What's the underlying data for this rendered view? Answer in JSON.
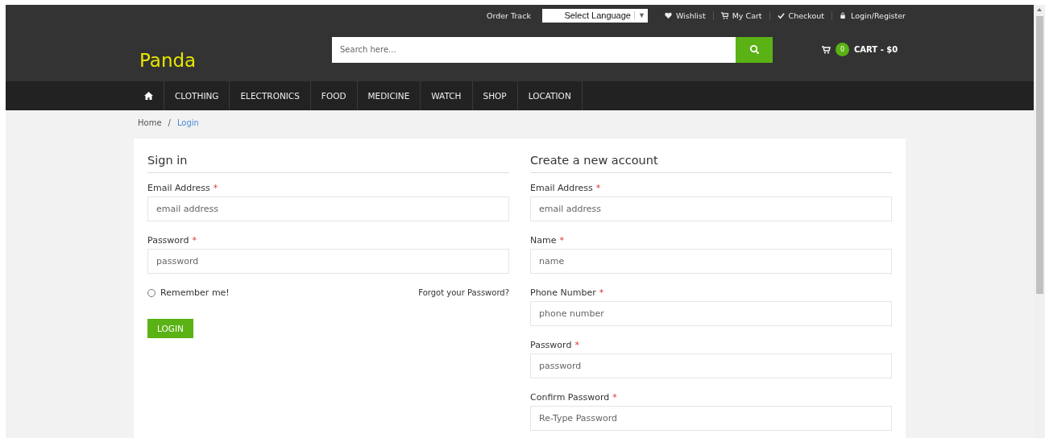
{
  "top_links": [
    {
      "kind": "text",
      "label": "Order Track"
    },
    {
      "kind": "select",
      "label": "Select Language",
      "caret": "▼"
    },
    {
      "kind": "wishlist",
      "label": "Wishlist"
    },
    {
      "kind": "cart",
      "label": "My Cart"
    },
    {
      "kind": "checkout",
      "label": "Checkout"
    },
    {
      "kind": "account",
      "label": "Login/Register"
    }
  ],
  "logo": "Panda",
  "search": {
    "placeholder": "Search here..."
  },
  "cart": {
    "count": "0",
    "label": "CART - $0"
  },
  "nav": [
    {
      "kind": "home"
    },
    {
      "kind": "text",
      "label": "CLOTHING"
    },
    {
      "kind": "text",
      "label": "ELECTRONICS"
    },
    {
      "kind": "text",
      "label": "FOOD"
    },
    {
      "kind": "text",
      "label": "MEDICINE"
    },
    {
      "kind": "text",
      "label": "WATCH"
    },
    {
      "kind": "text",
      "label": "SHOP"
    },
    {
      "kind": "text",
      "label": "LOCATION"
    }
  ],
  "breadcrumb": {
    "separator": "/",
    "items": [
      {
        "label": "Home",
        "selected": false
      },
      {
        "label": "Login",
        "selected": true
      }
    ]
  },
  "sign_in": {
    "title": "Sign in",
    "fields": [
      {
        "label": "Email Address",
        "required_mark": "*",
        "placeholder": "email address"
      },
      {
        "label": "Password",
        "required_mark": "*",
        "placeholder": "password"
      }
    ],
    "remember": {
      "label": "Remember me!",
      "checked": false
    },
    "forgot": "Forgot your Password?",
    "button": "LOGIN"
  },
  "create_account": {
    "title": "Create a new account",
    "fields": [
      {
        "label": "Email Address",
        "required_mark": "*",
        "placeholder": "email address"
      },
      {
        "label": "Name",
        "required_mark": "*",
        "placeholder": "name"
      },
      {
        "label": "Phone Number",
        "required_mark": "*",
        "placeholder": "phone number"
      },
      {
        "label": "Password",
        "required_mark": "*",
        "placeholder": "password"
      },
      {
        "label": "Confirm Password",
        "required_mark": "*",
        "placeholder": "Re-Type Password"
      }
    ]
  }
}
